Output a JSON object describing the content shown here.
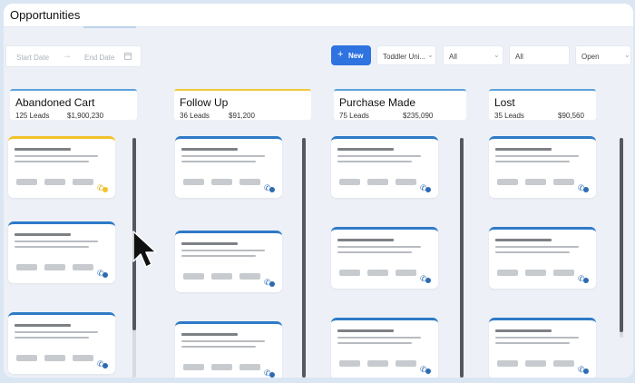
{
  "header": {
    "title": "Opportunities"
  },
  "toolbar": {
    "start_placeholder": "Start Date",
    "end_placeholder": "End Date",
    "new_button": "New",
    "filter_pipeline": "Toddler Uni...",
    "filter_stage": "All",
    "filter_owner": "All",
    "filter_status": "Open"
  },
  "columns": [
    {
      "name": "Abandoned Cart",
      "count": "125 Leads",
      "value": "$1,900,230",
      "accent": "#5ea1d9"
    },
    {
      "name": "Follow Up",
      "count": "36 Leads",
      "value": "$91,200",
      "accent": "#f0c93a"
    },
    {
      "name": "Purchase Made",
      "count": "75 Leads",
      "value": "$235,090",
      "accent": "#5ea1d9"
    },
    {
      "name": "Lost",
      "count": "35 Leads",
      "value": "$90,560",
      "accent": "#5ea1d9"
    }
  ],
  "colors": {
    "primary": "#2f73e0",
    "card_accent": "#2e7ac7",
    "card_accent_highlight": "#f2c22b"
  },
  "icons": [
    "calendar-icon",
    "arrow-right-icon",
    "plus-icon",
    "chevron-down-icon",
    "phone-icon",
    "chat-icon",
    "mouse-cursor-icon"
  ]
}
